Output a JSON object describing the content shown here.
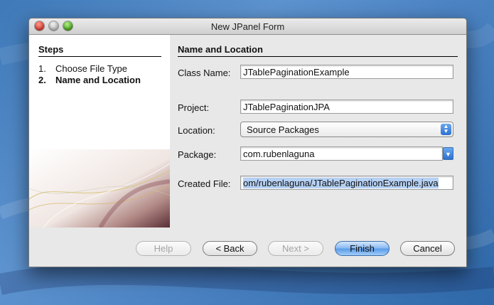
{
  "window": {
    "title": "New JPanel Form"
  },
  "steps": {
    "header": "Steps",
    "items": [
      {
        "num": "1.",
        "label": "Choose File Type"
      },
      {
        "num": "2.",
        "label": "Name and Location"
      }
    ]
  },
  "section": {
    "header": "Name and Location"
  },
  "form": {
    "class_name_label": "Class Name:",
    "class_name_value": "JTablePaginationExample",
    "project_label": "Project:",
    "project_value": "JTablePaginationJPA",
    "location_label": "Location:",
    "location_value": "Source Packages",
    "package_label": "Package:",
    "package_value": "com.rubenlaguna",
    "created_file_label": "Created File:",
    "created_file_value": "om/rubenlaguna/JTablePaginationExample.java"
  },
  "buttons": {
    "help": "Help",
    "back": "< Back",
    "next": "Next >",
    "finish": "Finish",
    "cancel": "Cancel"
  },
  "colors": {
    "accent": "#5c9de8",
    "desktop": "#4a82c2"
  }
}
